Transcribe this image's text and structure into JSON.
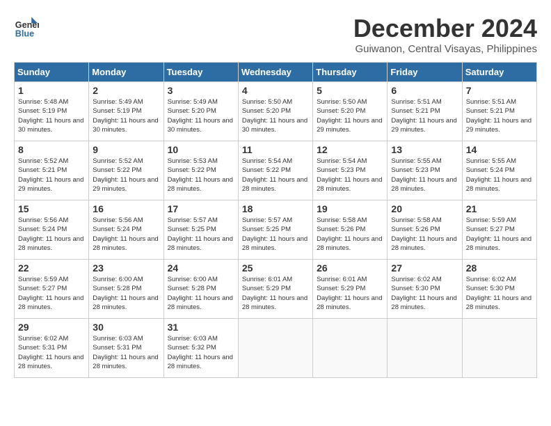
{
  "header": {
    "logo_general": "General",
    "logo_blue": "Blue",
    "month_title": "December 2024",
    "location": "Guiwanon, Central Visayas, Philippines"
  },
  "calendar": {
    "headers": [
      "Sunday",
      "Monday",
      "Tuesday",
      "Wednesday",
      "Thursday",
      "Friday",
      "Saturday"
    ],
    "weeks": [
      [
        {
          "day": "",
          "empty": true
        },
        {
          "day": "2",
          "sunrise": "5:49 AM",
          "sunset": "5:19 PM",
          "daylight": "11 hours and 30 minutes."
        },
        {
          "day": "3",
          "sunrise": "5:49 AM",
          "sunset": "5:20 PM",
          "daylight": "11 hours and 30 minutes."
        },
        {
          "day": "4",
          "sunrise": "5:50 AM",
          "sunset": "5:20 PM",
          "daylight": "11 hours and 30 minutes."
        },
        {
          "day": "5",
          "sunrise": "5:50 AM",
          "sunset": "5:20 PM",
          "daylight": "11 hours and 29 minutes."
        },
        {
          "day": "6",
          "sunrise": "5:51 AM",
          "sunset": "5:21 PM",
          "daylight": "11 hours and 29 minutes."
        },
        {
          "day": "7",
          "sunrise": "5:51 AM",
          "sunset": "5:21 PM",
          "daylight": "11 hours and 29 minutes."
        }
      ],
      [
        {
          "day": "1",
          "sunrise": "5:48 AM",
          "sunset": "5:19 PM",
          "daylight": "11 hours and 30 minutes.",
          "first": true
        },
        {
          "day": "9",
          "sunrise": "5:52 AM",
          "sunset": "5:22 PM",
          "daylight": "11 hours and 29 minutes."
        },
        {
          "day": "10",
          "sunrise": "5:53 AM",
          "sunset": "5:22 PM",
          "daylight": "11 hours and 28 minutes."
        },
        {
          "day": "11",
          "sunrise": "5:54 AM",
          "sunset": "5:22 PM",
          "daylight": "11 hours and 28 minutes."
        },
        {
          "day": "12",
          "sunrise": "5:54 AM",
          "sunset": "5:23 PM",
          "daylight": "11 hours and 28 minutes."
        },
        {
          "day": "13",
          "sunrise": "5:55 AM",
          "sunset": "5:23 PM",
          "daylight": "11 hours and 28 minutes."
        },
        {
          "day": "14",
          "sunrise": "5:55 AM",
          "sunset": "5:24 PM",
          "daylight": "11 hours and 28 minutes."
        }
      ],
      [
        {
          "day": "8",
          "sunrise": "5:52 AM",
          "sunset": "5:21 PM",
          "daylight": "11 hours and 29 minutes."
        },
        {
          "day": "16",
          "sunrise": "5:56 AM",
          "sunset": "5:24 PM",
          "daylight": "11 hours and 28 minutes."
        },
        {
          "day": "17",
          "sunrise": "5:57 AM",
          "sunset": "5:25 PM",
          "daylight": "11 hours and 28 minutes."
        },
        {
          "day": "18",
          "sunrise": "5:57 AM",
          "sunset": "5:25 PM",
          "daylight": "11 hours and 28 minutes."
        },
        {
          "day": "19",
          "sunrise": "5:58 AM",
          "sunset": "5:26 PM",
          "daylight": "11 hours and 28 minutes."
        },
        {
          "day": "20",
          "sunrise": "5:58 AM",
          "sunset": "5:26 PM",
          "daylight": "11 hours and 28 minutes."
        },
        {
          "day": "21",
          "sunrise": "5:59 AM",
          "sunset": "5:27 PM",
          "daylight": "11 hours and 28 minutes."
        }
      ],
      [
        {
          "day": "15",
          "sunrise": "5:56 AM",
          "sunset": "5:24 PM",
          "daylight": "11 hours and 28 minutes."
        },
        {
          "day": "23",
          "sunrise": "6:00 AM",
          "sunset": "5:28 PM",
          "daylight": "11 hours and 28 minutes."
        },
        {
          "day": "24",
          "sunrise": "6:00 AM",
          "sunset": "5:28 PM",
          "daylight": "11 hours and 28 minutes."
        },
        {
          "day": "25",
          "sunrise": "6:01 AM",
          "sunset": "5:29 PM",
          "daylight": "11 hours and 28 minutes."
        },
        {
          "day": "26",
          "sunrise": "6:01 AM",
          "sunset": "5:29 PM",
          "daylight": "11 hours and 28 minutes."
        },
        {
          "day": "27",
          "sunrise": "6:02 AM",
          "sunset": "5:30 PM",
          "daylight": "11 hours and 28 minutes."
        },
        {
          "day": "28",
          "sunrise": "6:02 AM",
          "sunset": "5:30 PM",
          "daylight": "11 hours and 28 minutes."
        }
      ],
      [
        {
          "day": "22",
          "sunrise": "5:59 AM",
          "sunset": "5:27 PM",
          "daylight": "11 hours and 28 minutes."
        },
        {
          "day": "30",
          "sunrise": "6:03 AM",
          "sunset": "5:31 PM",
          "daylight": "11 hours and 28 minutes."
        },
        {
          "day": "31",
          "sunrise": "6:03 AM",
          "sunset": "5:32 PM",
          "daylight": "11 hours and 28 minutes."
        },
        {
          "day": "",
          "empty": true
        },
        {
          "day": "",
          "empty": true
        },
        {
          "day": "",
          "empty": true
        },
        {
          "day": "",
          "empty": true
        }
      ],
      [
        {
          "day": "29",
          "sunrise": "6:02 AM",
          "sunset": "5:31 PM",
          "daylight": "11 hours and 28 minutes."
        },
        {
          "day": "",
          "empty": true
        },
        {
          "day": "",
          "empty": true
        },
        {
          "day": "",
          "empty": true
        },
        {
          "day": "",
          "empty": true
        },
        {
          "day": "",
          "empty": true
        },
        {
          "day": "",
          "empty": true
        }
      ]
    ]
  }
}
